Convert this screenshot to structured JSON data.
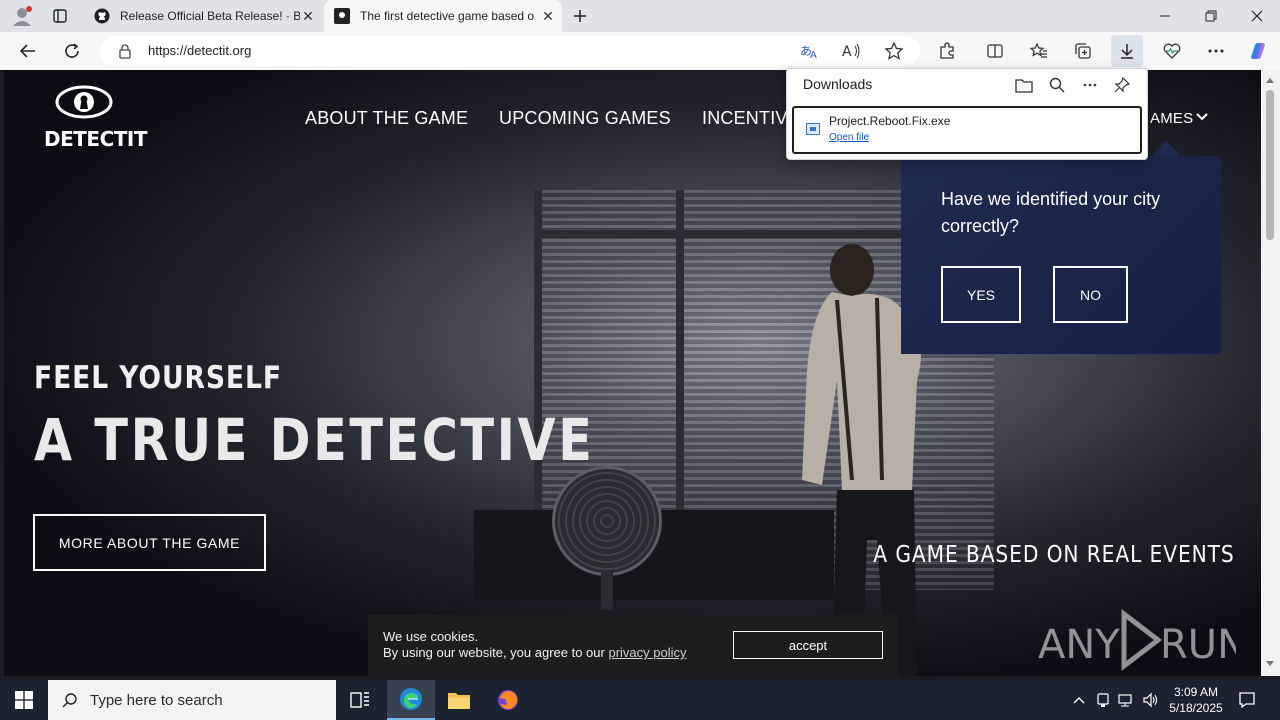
{
  "browser": {
    "tabs": [
      {
        "title": "Release Official Beta Release! · Bl",
        "icon": "github-icon",
        "active": false
      },
      {
        "title": "The first detective game based on",
        "icon": "detectit-favicon",
        "active": true
      }
    ],
    "url": "https://detectit.org"
  },
  "downloads": {
    "title": "Downloads",
    "file_name": "Project.Reboot.Fix.exe",
    "open_label": "Open file"
  },
  "site": {
    "logo_text": "DETECTIT",
    "nav": {
      "about": "ABOUT THE GAME",
      "upcoming": "UPCOMING GAMES",
      "incentives": "INCENTIV",
      "games": "AMES"
    },
    "hero_sub": "FEEL YOURSELF",
    "hero_title": "A TRUE DETECTIVE",
    "more_button": "MORE ABOUT THE GAME",
    "tagline": "A GAME BASED ON REAL EVENTS",
    "city_popup": {
      "question": "Have we identified your city correctly?",
      "yes": "YES",
      "no": "NO"
    },
    "cookie": {
      "line1": "We use cookies.",
      "line2_prefix": "By using our website, you agree to our ",
      "link": "privacy policy",
      "accept": "accept"
    },
    "watermark": "ANY RUN"
  },
  "taskbar": {
    "search_placeholder": "Type here to search",
    "time": "3:09 AM",
    "date": "5/18/2025"
  },
  "colors": {
    "popup_bg": "#1f2a4f",
    "taskbar_bg": "#1c2330",
    "link_blue": "#0f5bbd"
  }
}
